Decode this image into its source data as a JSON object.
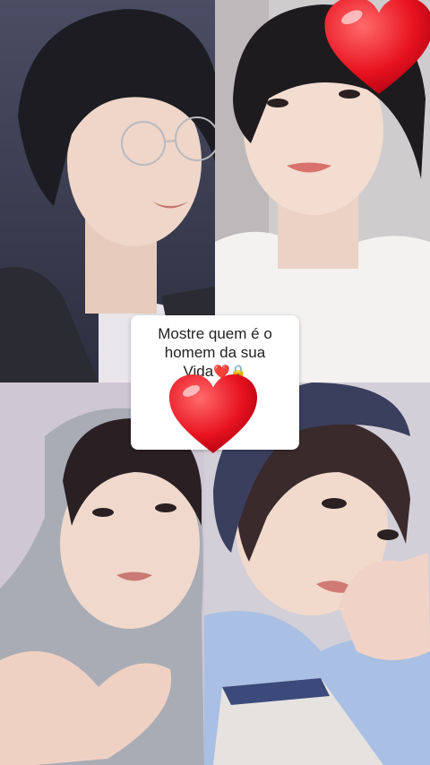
{
  "sticker": {
    "line1": "Mostre quem é o",
    "line2": "homem da sua",
    "line3": "Vida",
    "emojis": "❤️🔒"
  },
  "photos": [
    {
      "name": "top-left-portrait"
    },
    {
      "name": "top-right-portrait"
    },
    {
      "name": "bottom-left-portrait"
    },
    {
      "name": "bottom-right-portrait"
    }
  ],
  "colors": {
    "heart": "#e8121f",
    "heart_highlight": "#ff8a8a"
  }
}
